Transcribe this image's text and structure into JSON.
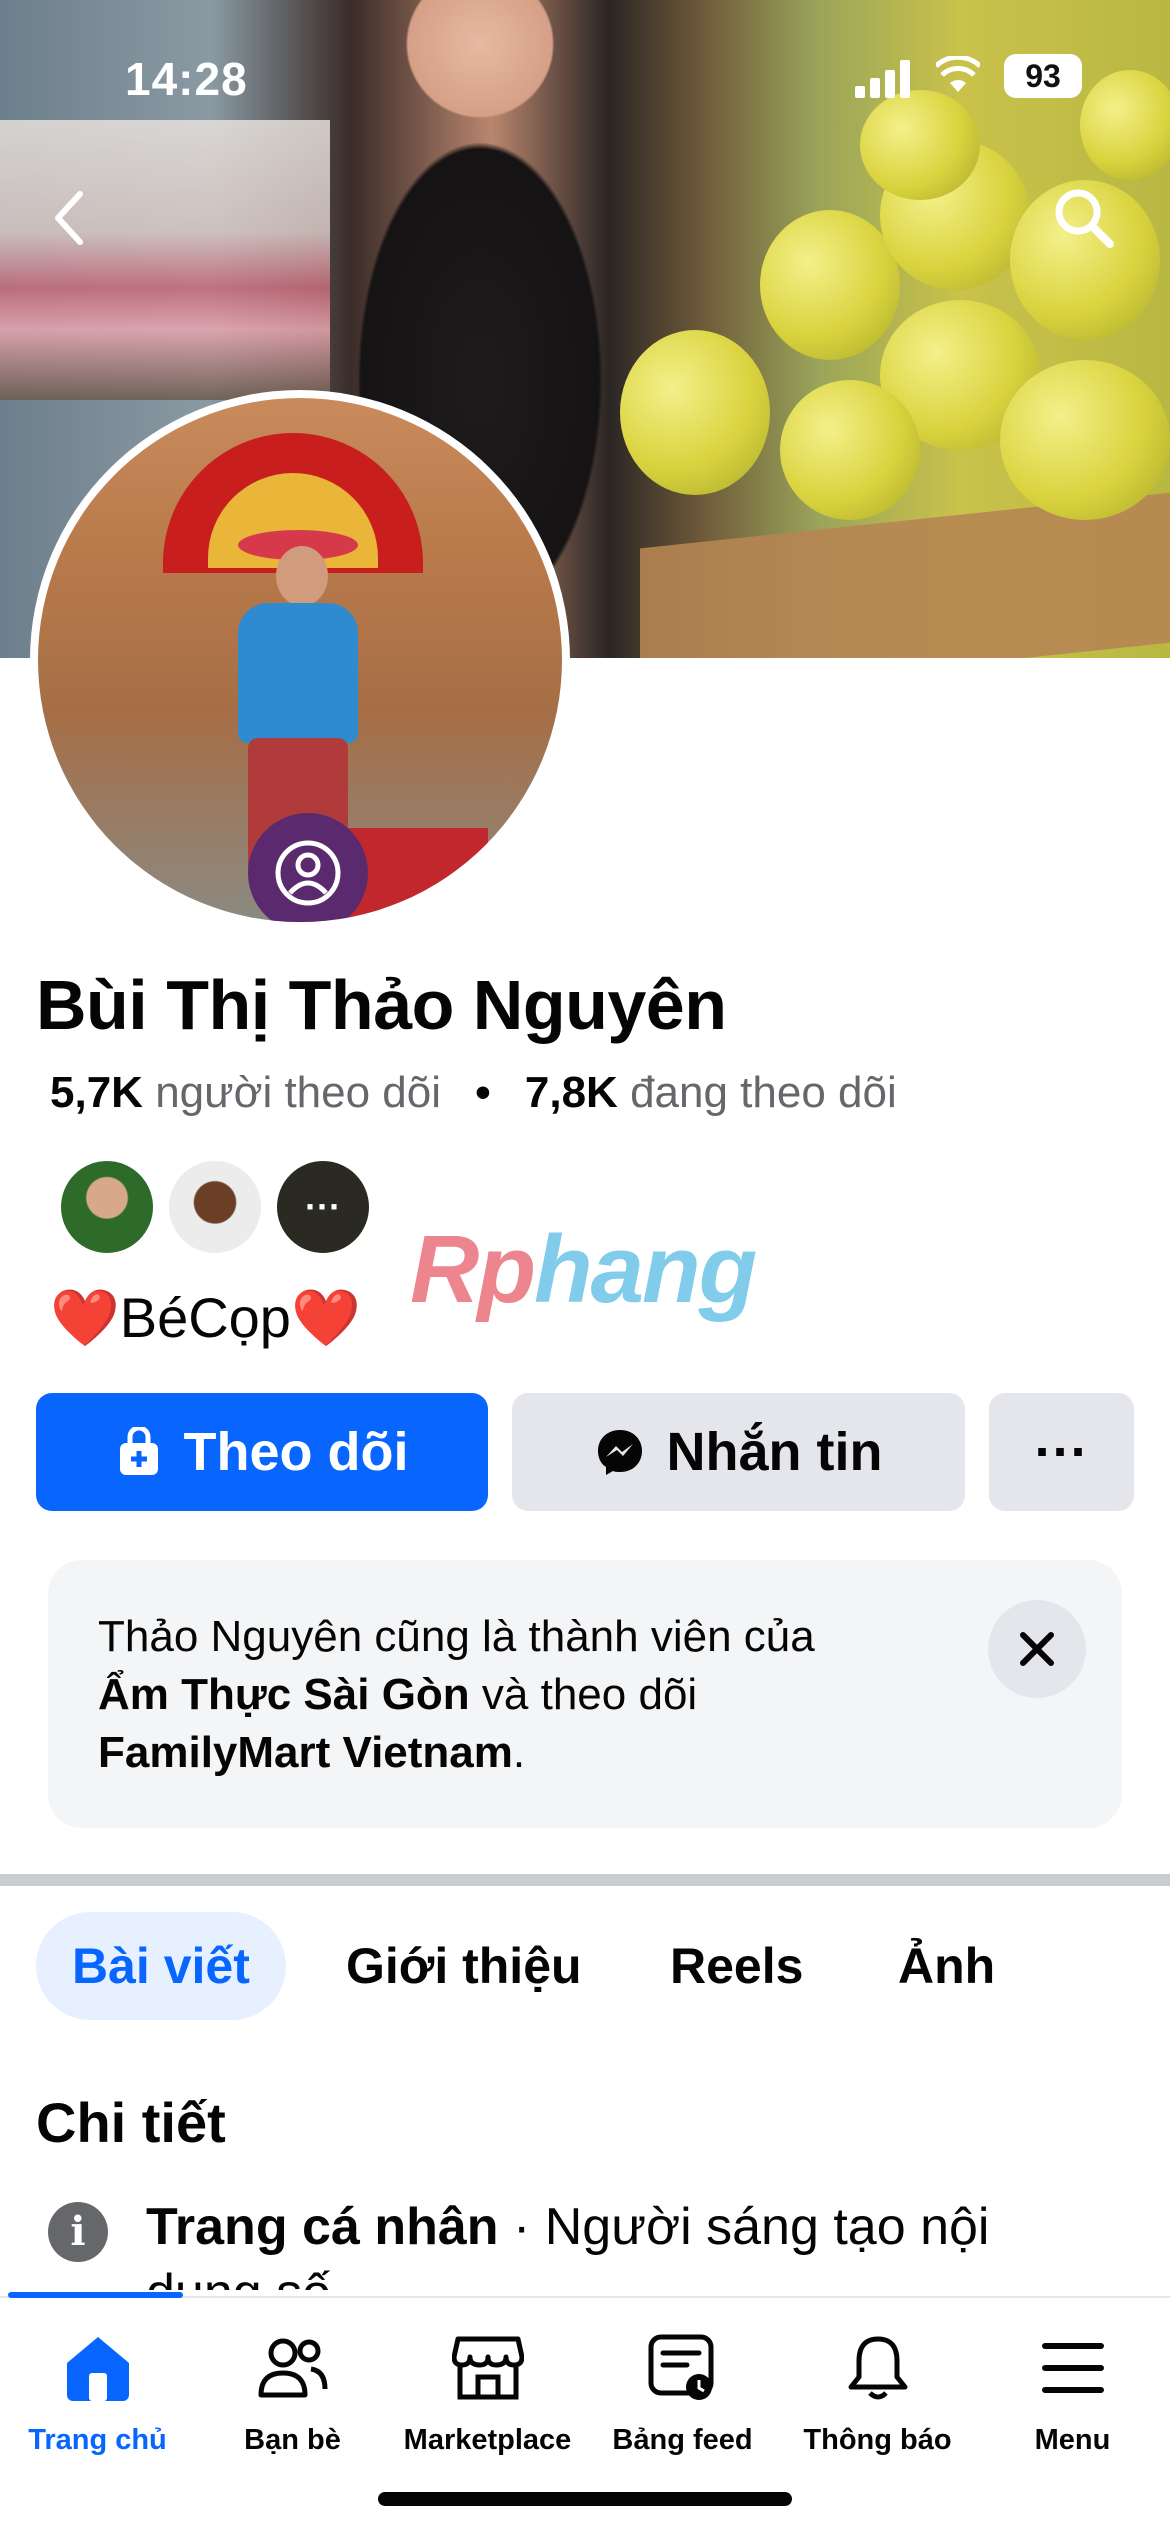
{
  "status_bar": {
    "time": "14:28",
    "battery": "93"
  },
  "profile": {
    "name": "Bùi Thị Thảo Nguyên",
    "followers_count": "5,7K",
    "followers_label": "người theo dõi",
    "following_count": "7,8K",
    "following_label": "đang theo dõi",
    "separator": "•",
    "bio": "❤️BéCọp❤️"
  },
  "watermark": {
    "part1": "Rp",
    "part2": "hang"
  },
  "actions": {
    "follow_label": "Theo dõi",
    "message_label": "Nhắn tin",
    "more_label": "···"
  },
  "mutual_card": {
    "line1": "Thảo Nguyên cũng là thành viên của",
    "group_name": "Ẩm Thực Sài Gòn",
    "middle": " và theo dõi",
    "page_name": "FamilyMart Vietnam",
    "end": "."
  },
  "tabs": [
    {
      "label": "Bài viết",
      "active": true
    },
    {
      "label": "Giới thiệu",
      "active": false
    },
    {
      "label": "Reels",
      "active": false
    },
    {
      "label": "Ảnh",
      "active": false
    }
  ],
  "details": {
    "title": "Chi tiết",
    "row_bold": "Trang cá nhân",
    "row_text": " · Người sáng tạo nội dung số"
  },
  "bottom_nav": [
    {
      "label": "Trang chủ",
      "icon": "home-icon",
      "active": true
    },
    {
      "label": "Bạn bè",
      "icon": "friends-icon",
      "active": false
    },
    {
      "label": "Marketplace",
      "icon": "marketplace-icon",
      "active": false
    },
    {
      "label": "Bảng feed",
      "icon": "feed-icon",
      "active": false
    },
    {
      "label": "Thông báo",
      "icon": "bell-icon",
      "active": false
    },
    {
      "label": "Menu",
      "icon": "menu-icon",
      "active": false
    }
  ],
  "colors": {
    "accent": "#0866ff",
    "button_gray": "#e4e6eb",
    "secondary_text": "#65676b"
  }
}
